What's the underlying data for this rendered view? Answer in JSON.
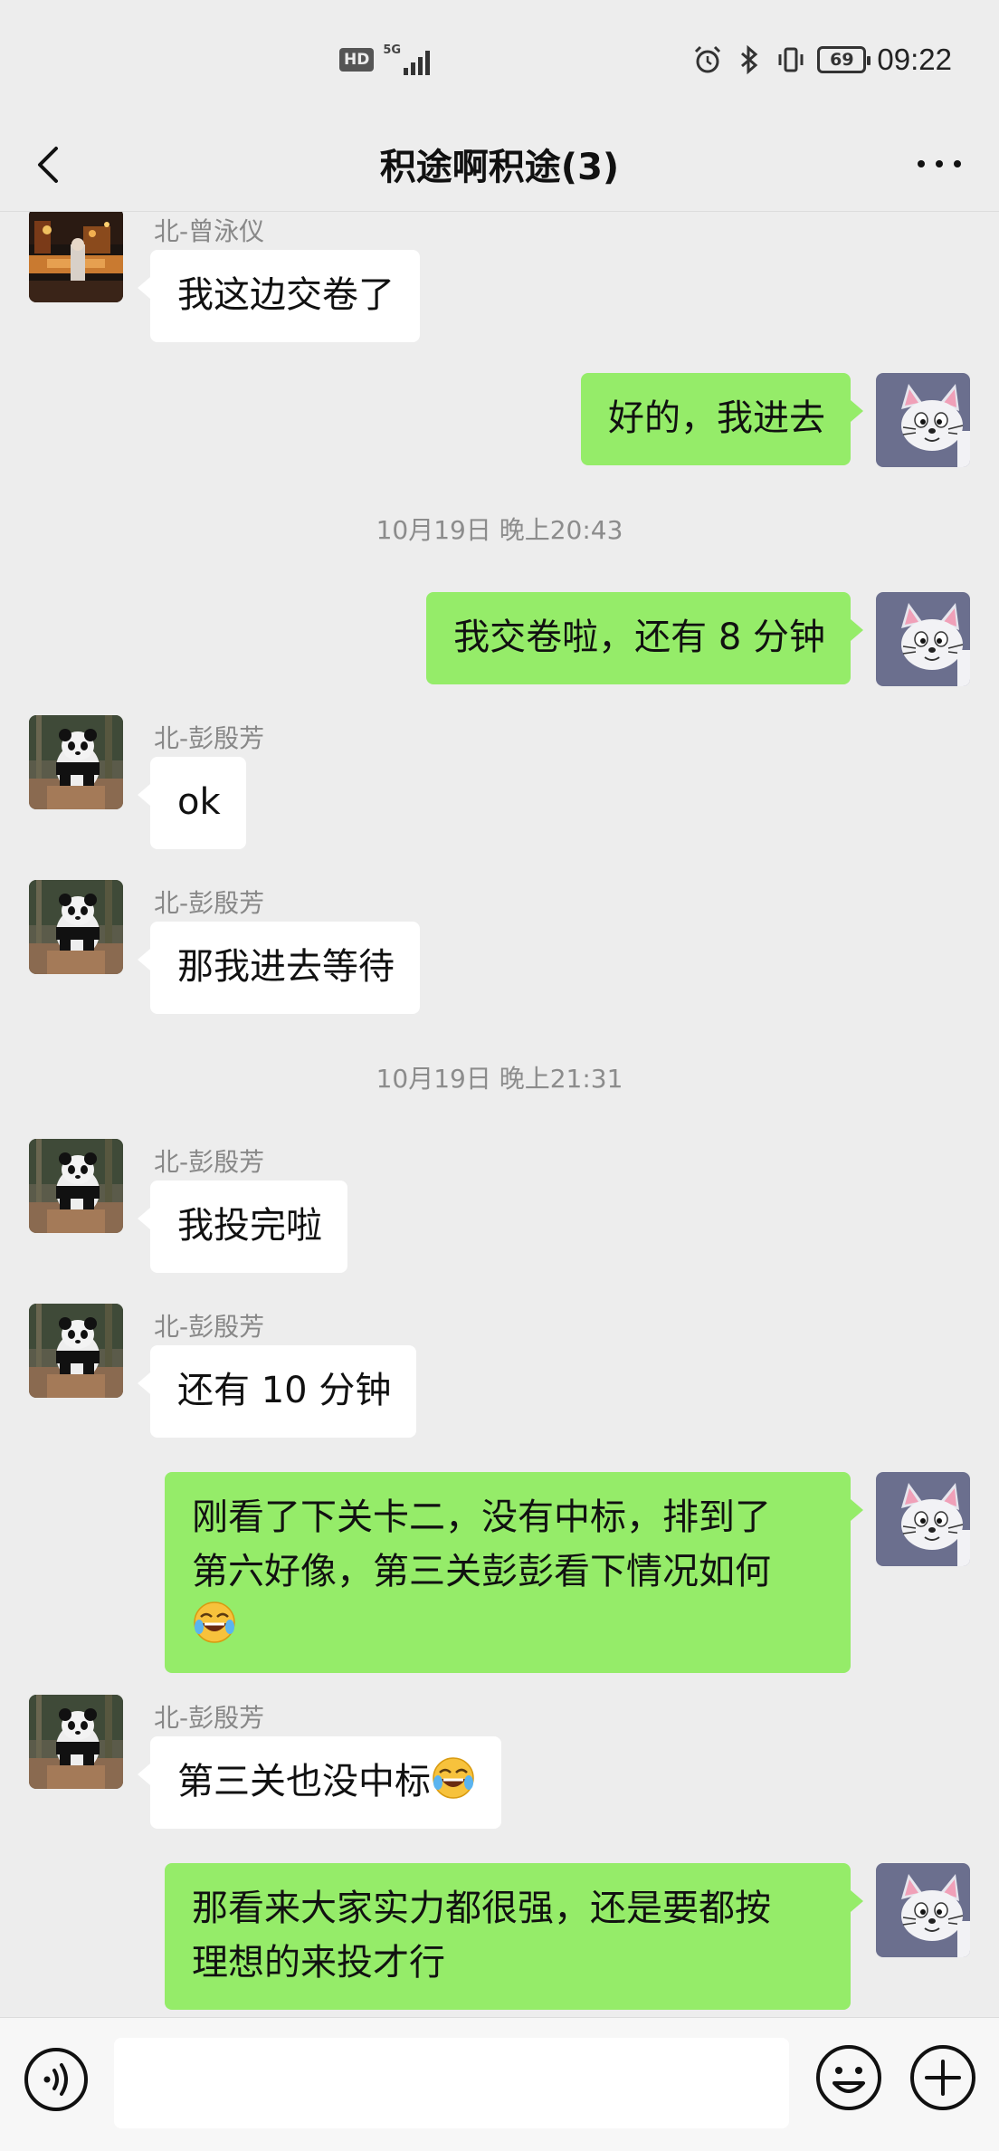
{
  "status_bar": {
    "hd_label": "HD",
    "network_label": "5G",
    "battery_level": "69",
    "time": "09:22"
  },
  "header": {
    "title": "积途啊积途(3)"
  },
  "messages": [
    {
      "type": "in",
      "sender": "北-曾泳仪",
      "text": "我这边交卷了",
      "avatar": "city-night-avatar"
    },
    {
      "type": "out",
      "text": "好的，我进去",
      "avatar": "cartoon-cat-avatar"
    },
    {
      "type": "time",
      "text": "10月19日 晚上20:43"
    },
    {
      "type": "out",
      "text": "我交卷啦，还有 8 分钟",
      "avatar": "cartoon-cat-avatar"
    },
    {
      "type": "in",
      "sender": "北-彭殷芳",
      "text": "ok",
      "avatar": "panda-avatar"
    },
    {
      "type": "in",
      "sender": "北-彭殷芳",
      "text": "那我进去等待",
      "avatar": "panda-avatar"
    },
    {
      "type": "time",
      "text": "10月19日 晚上21:31"
    },
    {
      "type": "in",
      "sender": "北-彭殷芳",
      "text": "我投完啦",
      "avatar": "panda-avatar"
    },
    {
      "type": "in",
      "sender": "北-彭殷芳",
      "text": "还有 10 分钟",
      "avatar": "panda-avatar"
    },
    {
      "type": "out",
      "text_line1": "刚看了下关卡二，没有中标，排到了",
      "text_line2": "第六好像，第三关彭彭看下情况如何",
      "emoji": "laugh-cry-emoji",
      "avatar": "cartoon-cat-avatar"
    },
    {
      "type": "in",
      "sender": "北-彭殷芳",
      "text": "第三关也没中标",
      "emoji": "laugh-cry-emoji",
      "avatar": "panda-avatar"
    },
    {
      "type": "out",
      "text_line1": "那看来大家实力都很强，还是要都按",
      "text_line2": "理想的来投才行",
      "avatar": "cartoon-cat-avatar"
    }
  ],
  "input_bar": {
    "value": "",
    "icons": [
      "voice-icon",
      "emoji-icon",
      "plus-icon"
    ]
  },
  "colors": {
    "background": "#ededed",
    "outgoing_bubble": "#95ec69",
    "incoming_bubble": "#ffffff"
  }
}
